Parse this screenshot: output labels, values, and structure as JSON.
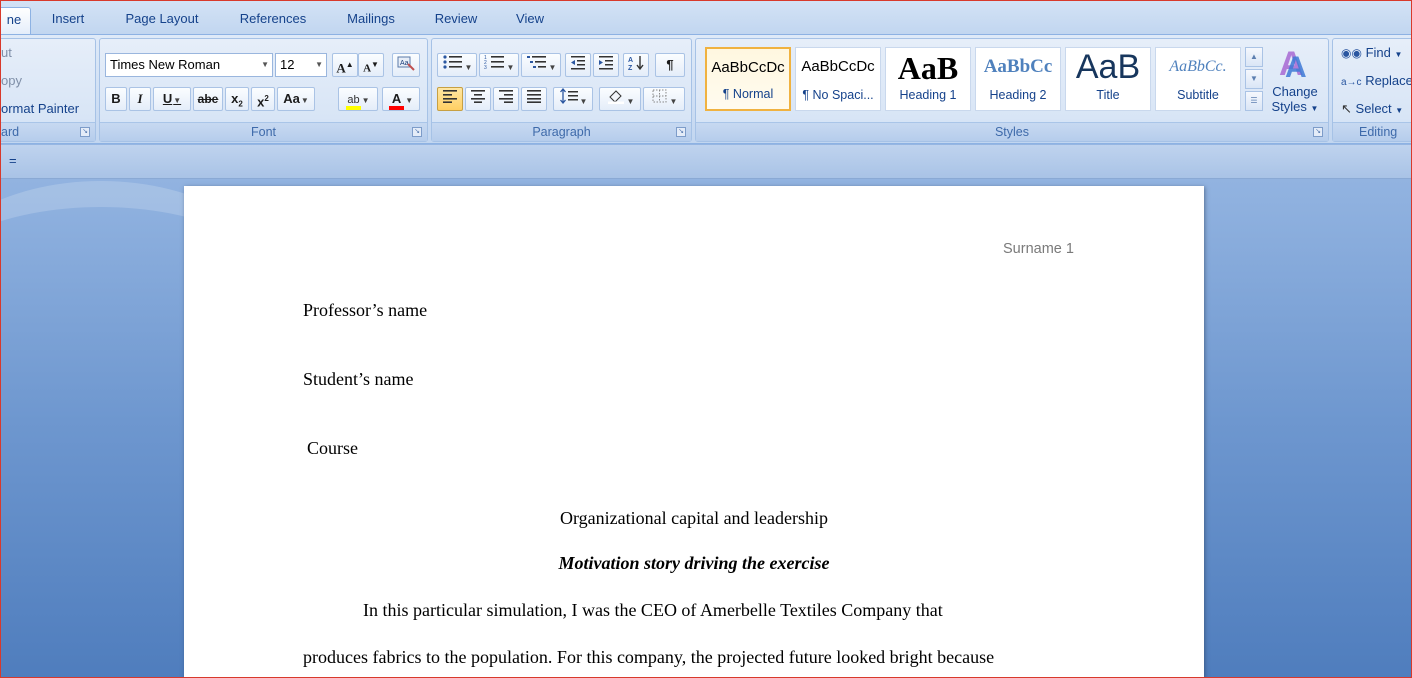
{
  "tabs": [
    {
      "label": "ne",
      "active": true
    },
    {
      "label": "Insert"
    },
    {
      "label": "Page Layout"
    },
    {
      "label": "References"
    },
    {
      "label": "Mailings"
    },
    {
      "label": "Review"
    },
    {
      "label": "View"
    }
  ],
  "clipboard": {
    "cut": "ut",
    "copy": "opy",
    "format_painter": "ormat Painter",
    "group_label": "ard"
  },
  "font": {
    "name": "Times New Roman",
    "size": "12",
    "grow": "A",
    "shrink": "A",
    "bold": "B",
    "italic": "I",
    "underline": "U",
    "strikethrough": "abe",
    "subscript": "x",
    "superscript": "x",
    "change_case": "Aa",
    "highlight": "ab",
    "font_color": "A",
    "group_label": "Font"
  },
  "paragraph": {
    "group_label": "Paragraph",
    "show_marks": "¶"
  },
  "styles": {
    "group_label": "Styles",
    "items": [
      {
        "preview": "AaBbCcDc",
        "name": "¶ Normal",
        "selected": true
      },
      {
        "preview": "AaBbCcDc",
        "name": "¶ No Spaci..."
      },
      {
        "preview": "AaB",
        "name": "Heading 1"
      },
      {
        "preview": "AaBbCc",
        "name": "Heading 2"
      },
      {
        "preview": "AaB",
        "name": "Title"
      },
      {
        "preview": "AaBbCc.",
        "name": "Subtitle"
      }
    ],
    "change_styles_line1": "Change",
    "change_styles_line2": "Styles"
  },
  "editing": {
    "find": "Find",
    "replace": "Replace",
    "select": "Select",
    "group_label": "Editing"
  },
  "quick_access": {
    "customize": "="
  },
  "document": {
    "header_text": "Surname 1",
    "professor": "Professor’s name",
    "student": "Student’s name",
    "course": "Course",
    "title": "Organizational capital and leadership",
    "subtitle": "Motivation story driving the exercise",
    "para_line1": "In this particular simulation, I was the CEO of Amerbelle Textiles Company that",
    "para_line2": "produces fabrics to the population. For this company, the projected future looked bright because"
  },
  "colors": {
    "accent": "#15428b",
    "highlight_yellow": "#ffff00",
    "font_color_red": "#ff0000",
    "heading_blue": "#4f81bd",
    "title_blue": "#17365d"
  }
}
